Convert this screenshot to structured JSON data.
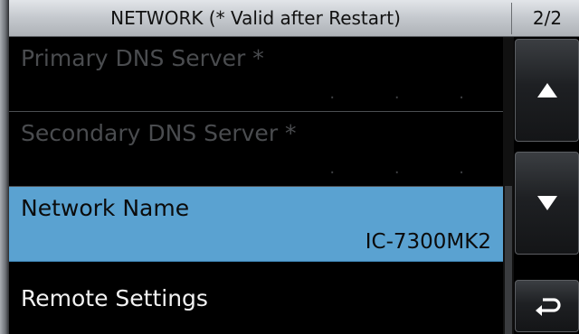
{
  "header": {
    "title": "NETWORK (* Valid after Restart)",
    "page_indicator": "2/2"
  },
  "menu": {
    "items": [
      {
        "label": "Primary DNS Server *",
        "value": ". . .",
        "state": "disabled"
      },
      {
        "label": "Secondary DNS Server *",
        "value": ". . .",
        "state": "disabled"
      },
      {
        "label": "Network Name",
        "value": "IC-7300MK2",
        "state": "selected"
      },
      {
        "label": "Remote Settings",
        "value": "",
        "state": "normal"
      }
    ]
  },
  "buttons": {
    "up_icon": "triangle-up-icon",
    "down_icon": "triangle-down-icon",
    "return_icon": "return-arrow-icon"
  },
  "colors": {
    "selection": "#5aa2d1",
    "background": "#000000",
    "titlebar": "#c4c8cd"
  }
}
